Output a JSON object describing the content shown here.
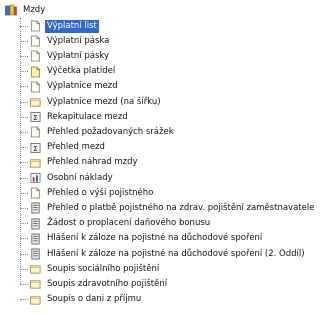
{
  "tree": {
    "root": {
      "label": "Mzdy",
      "icon": "books-folder-icon"
    },
    "items": [
      {
        "label": "Výplatní list",
        "icon": "document-icon",
        "selected": true
      },
      {
        "label": "Výplatní páska",
        "icon": "document-icon"
      },
      {
        "label": "Výplatní pásky",
        "icon": "document-icon"
      },
      {
        "label": "Výčetka platidel",
        "icon": "document-yellow-icon"
      },
      {
        "label": "Výplatnice mezd",
        "icon": "document-icon"
      },
      {
        "label": "Výplatnice mezd (na šířku)",
        "icon": "landscape-document-icon"
      },
      {
        "label": "Rekapitulace mezd",
        "icon": "summary-report-icon"
      },
      {
        "label": "Přehled požadovaných srážek",
        "icon": "document-icon"
      },
      {
        "label": "Přehled mezd",
        "icon": "summary-report-icon"
      },
      {
        "label": "Přehled náhrad mzdy",
        "icon": "landscape-document-icon"
      },
      {
        "label": "Osobní náklady",
        "icon": "costs-chart-icon"
      },
      {
        "label": "Přehled o výši pojistného",
        "icon": "document-icon"
      },
      {
        "label": "Přehled o platbě pojistného na zdrav. pojištění zaměstnavatele",
        "icon": "form-icon"
      },
      {
        "label": "Žádost o proplacení daňového bonusu",
        "icon": "form-icon"
      },
      {
        "label": "Hlášení k záloze na pojistné na důchodové spoření",
        "icon": "form-icon"
      },
      {
        "label": "Hlášení k záloze na pojistné na důchodové spoření (2. Oddíl)",
        "icon": "form-icon"
      },
      {
        "label": "Soupis sociálního pojištění",
        "icon": "landscape-document-icon"
      },
      {
        "label": "Soupis zdravotního pojištění",
        "icon": "landscape-document-icon"
      },
      {
        "label": "Soupis o dani z příjmu",
        "icon": "landscape-document-icon"
      }
    ]
  },
  "colors": {
    "selection": "#3169c6",
    "selected_text": "#ffffff",
    "page_fill": "#fffbe8",
    "folder_accent": "#d9a520"
  }
}
